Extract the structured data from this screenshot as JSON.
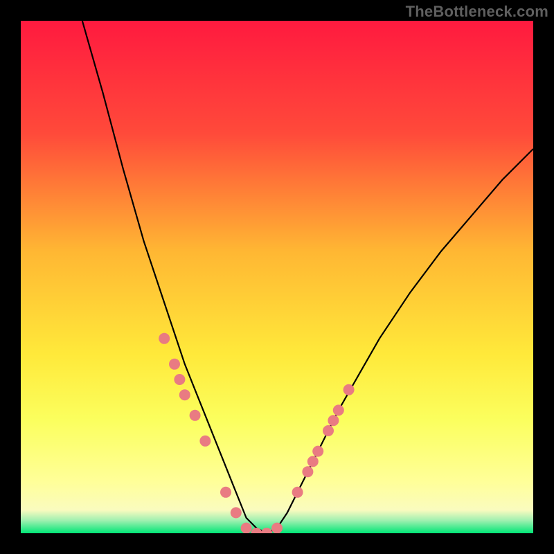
{
  "meta": {
    "watermark": "TheBottleneck.com"
  },
  "chart_data": {
    "type": "line",
    "title": "",
    "xlabel": "",
    "ylabel": "",
    "xlim": [
      0,
      100
    ],
    "ylim": [
      0,
      100
    ],
    "grid": false,
    "legend": false,
    "background_gradient": [
      {
        "pos": 0.0,
        "color": "#ff1a3f"
      },
      {
        "pos": 0.22,
        "color": "#ff4a3a"
      },
      {
        "pos": 0.45,
        "color": "#ffb733"
      },
      {
        "pos": 0.65,
        "color": "#ffe93a"
      },
      {
        "pos": 0.78,
        "color": "#fbff5e"
      },
      {
        "pos": 0.9,
        "color": "#ffff99"
      },
      {
        "pos": 0.955,
        "color": "#fafbbf"
      },
      {
        "pos": 0.975,
        "color": "#a0f0b0"
      },
      {
        "pos": 1.0,
        "color": "#00e676"
      }
    ],
    "series": [
      {
        "name": "bottleneck-curve",
        "description": "V-shaped bottleneck curve; y is percentage mismatch vs x (relative hardware balance). Minimum ~0 around x=44..50.",
        "x": [
          12,
          16,
          20,
          24,
          26,
          28,
          30,
          32,
          34,
          36,
          38,
          40,
          42,
          44,
          46,
          48,
          50,
          52,
          54,
          56,
          58,
          60,
          62,
          66,
          70,
          76,
          82,
          88,
          94,
          100
        ],
        "y": [
          100,
          86,
          71,
          57,
          51,
          45,
          39,
          33,
          28,
          23,
          18,
          13,
          8,
          3,
          1,
          0,
          1,
          4,
          8,
          12,
          16,
          20,
          24,
          31,
          38,
          47,
          55,
          62,
          69,
          75
        ]
      }
    ],
    "markers": {
      "name": "pink-dots",
      "color": "#e97b82",
      "description": "Highlighted sample points along the curve in the lower region.",
      "x": [
        28,
        30,
        31,
        32,
        34,
        36,
        40,
        42,
        44,
        46,
        48,
        50,
        54,
        56,
        57,
        58,
        60,
        61,
        62,
        64
      ],
      "y": [
        38,
        33,
        30,
        27,
        23,
        18,
        8,
        4,
        1,
        0,
        0,
        1,
        8,
        12,
        14,
        16,
        20,
        22,
        24,
        28
      ]
    }
  }
}
